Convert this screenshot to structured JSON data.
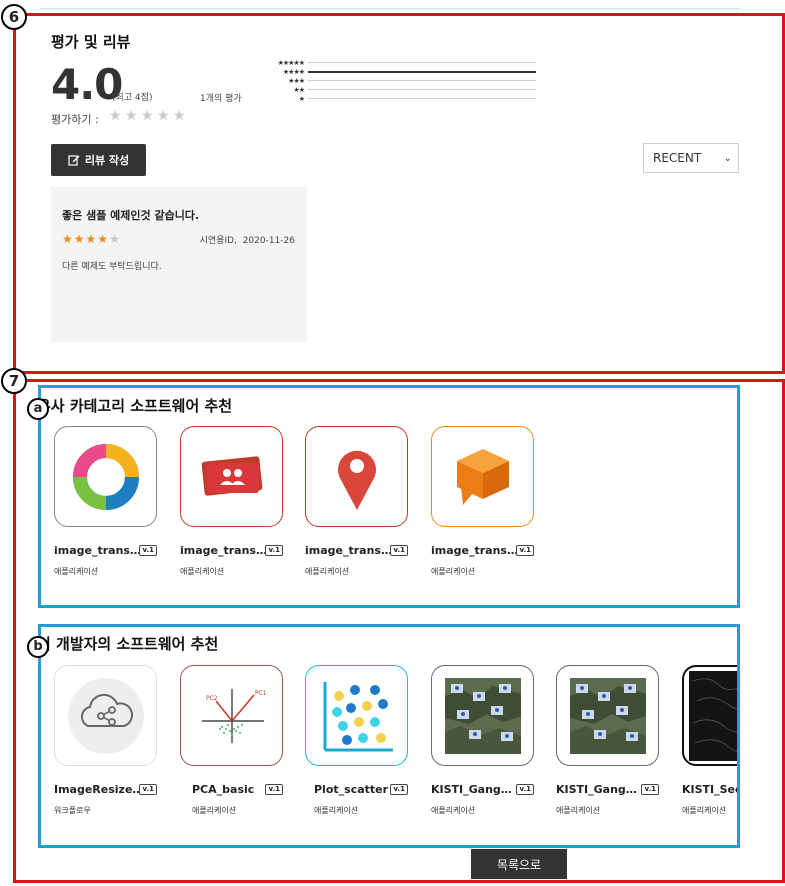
{
  "markers": {
    "m6": "6",
    "m7": "7",
    "ma": "a",
    "mb": "b"
  },
  "rating": {
    "section_title": "평가 및 리뷰",
    "score": "4.0",
    "max_label": "(최고 4점)",
    "count_label": "1개의 평가",
    "rate_label": "평가하기 :",
    "distribution": [
      "★★★★★",
      "★★★★",
      "★★★",
      "★★",
      "★"
    ],
    "write_button": "리뷰 작성",
    "sort_value": "RECENT"
  },
  "review": {
    "title": "좋은 샘플 예제인것 같습니다.",
    "stars": 4,
    "author": "시연용ID,",
    "date": "2020-11-26",
    "body": "다른 예제도 부탁드립니다."
  },
  "similar": {
    "title": "유사 카테고리 소프트웨어 추천",
    "items": [
      {
        "name": "image_trans…",
        "version": "v.1",
        "type": "애플리케이션",
        "icon": "webex-ring-icon",
        "border": "#888888"
      },
      {
        "name": "image_trans…",
        "version": "v.1",
        "type": "애플리케이션",
        "icon": "contact-cards-icon",
        "border": "#c0392b"
      },
      {
        "name": "image_trans…",
        "version": "v.1",
        "type": "애플리케이션",
        "icon": "map-pin-icon",
        "border": "#c0392b"
      },
      {
        "name": "image_trans…",
        "version": "v.1",
        "type": "애플리케이션",
        "icon": "chat-cube-icon",
        "border": "#f08a1c"
      }
    ]
  },
  "developer": {
    "title": "이 개발자의 소프트웨어 추천",
    "items": [
      {
        "name": "ImageResize…",
        "version": "v.1",
        "type": "워크플로우",
        "icon": "cloud-share-icon",
        "border": "#dddddd"
      },
      {
        "name": "PCA_basic",
        "version": "v.1",
        "type": "애플리케이션",
        "icon": "pca-plot-icon",
        "border": "#a0524d"
      },
      {
        "name": "Plot_scatter",
        "version": "v.1",
        "type": "애플리케이션",
        "icon": "scatter-plot-icon",
        "border": "#21b8c6"
      },
      {
        "name": "KISTI_Gang…",
        "version": "v.1",
        "type": "애플리케이션",
        "icon": "map-weather-icon",
        "border": "#666666"
      },
      {
        "name": "KISTI_Gang…",
        "version": "v.1",
        "type": "애플리케이션",
        "icon": "map-weather-icon",
        "border": "#666666"
      },
      {
        "name": "KISTI_Seou…",
        "version": "",
        "type": "애플리케이션",
        "icon": "dark-map-icon",
        "border": "#111111"
      }
    ]
  },
  "list_button": "목록으로"
}
